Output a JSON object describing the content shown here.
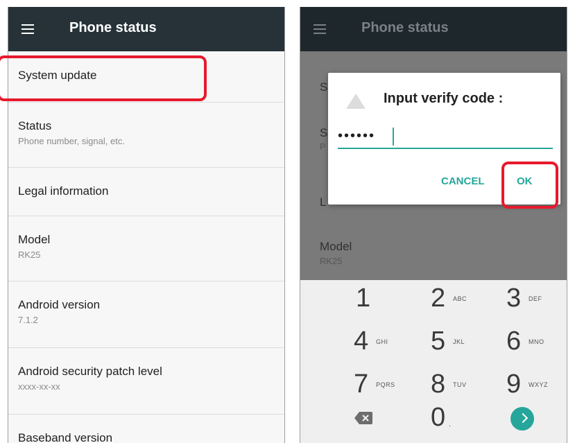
{
  "left_screen": {
    "appbar": {
      "title": "Phone status",
      "menu_icon": "hamburger-menu-icon"
    },
    "items": [
      {
        "title": "System update",
        "summary": ""
      },
      {
        "title": "Status",
        "summary": "Phone number, signal, etc."
      },
      {
        "title": "Legal information",
        "summary": ""
      },
      {
        "title": "Model",
        "summary": "RK25"
      },
      {
        "title": "Android version",
        "summary": "7.1.2"
      },
      {
        "title": "Android security patch level",
        "summary": "xxxx-xx-xx"
      },
      {
        "title": "Baseband version",
        "summary": ""
      }
    ]
  },
  "right_screen": {
    "appbar": {
      "title": "Phone status",
      "menu_icon": "hamburger-menu-icon"
    },
    "background_items": [
      {
        "title": "S",
        "summary": ""
      },
      {
        "title": "S",
        "summary": "P"
      },
      {
        "title": "L",
        "summary": ""
      },
      {
        "title": "Model",
        "summary": "RK25"
      }
    ],
    "dialog": {
      "title": "Input verify code :",
      "input_value": "••••••",
      "cancel_label": "CANCEL",
      "ok_label": "OK"
    },
    "keypad": [
      {
        "num": "1",
        "letters": ""
      },
      {
        "num": "2",
        "letters": "ABC"
      },
      {
        "num": "3",
        "letters": "DEF"
      },
      {
        "num": "4",
        "letters": "GHI"
      },
      {
        "num": "5",
        "letters": "JKL"
      },
      {
        "num": "6",
        "letters": "MNO"
      },
      {
        "num": "7",
        "letters": "PQRS"
      },
      {
        "num": "8",
        "letters": "TUV"
      },
      {
        "num": "9",
        "letters": "WXYZ"
      },
      {
        "num": "0",
        "letters": "."
      }
    ],
    "keypad_extra": {
      "backspace_icon": "backspace-icon",
      "next_icon": "next-arrow-icon"
    }
  },
  "colors": {
    "appbar": "#263238",
    "accent": "#26a69a",
    "highlight": "#e8192c"
  }
}
